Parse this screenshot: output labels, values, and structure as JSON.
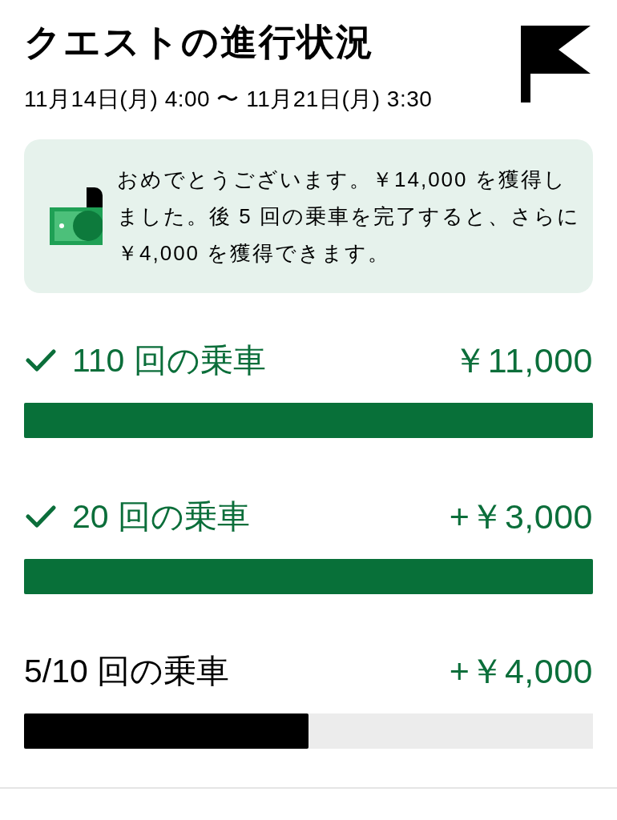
{
  "header": {
    "title": "クエストの進行状況",
    "period": "11月14日(月) 4:00 〜 11月21日(月) 3:30"
  },
  "notice": {
    "message": "おめでとうございます。￥14,000 を獲得しました。後 5 回の乗車を完了すると、さらに￥4,000 を獲得できます。"
  },
  "milestones": [
    {
      "label": "110 回の乗車",
      "reward": "￥11,000",
      "completed": true,
      "level": 1
    },
    {
      "label": "20 回の乗車",
      "reward": "+￥3,000",
      "completed": true,
      "level": 1
    },
    {
      "label": "5/10 回の乗車",
      "reward": "+￥4,000",
      "completed": false,
      "level": 0.5
    }
  ]
}
